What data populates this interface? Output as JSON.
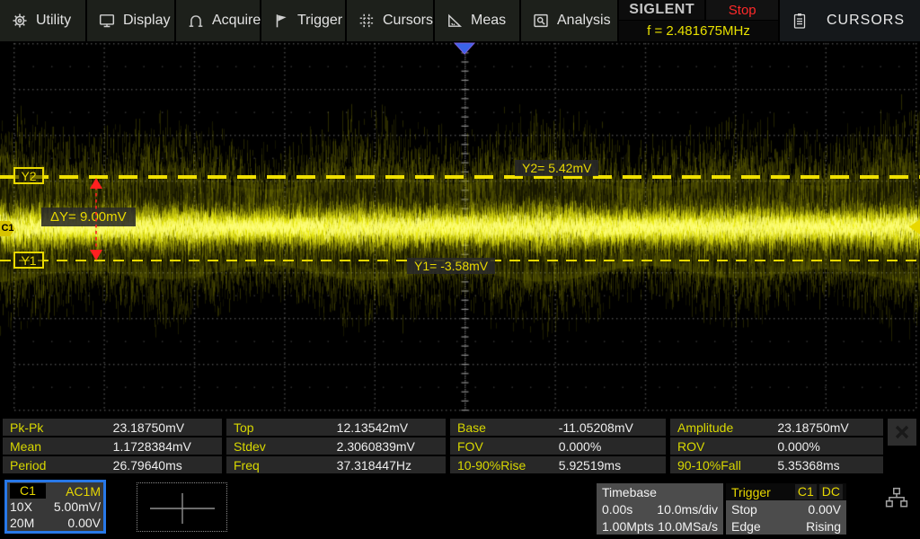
{
  "menu": {
    "items": [
      {
        "label": "Utility",
        "icon": "gear-icon"
      },
      {
        "label": "Display",
        "icon": "display-icon"
      },
      {
        "label": "Acquire",
        "icon": "acquire-icon"
      },
      {
        "label": "Trigger",
        "icon": "flag-icon"
      },
      {
        "label": "Cursors",
        "icon": "cursors-icon"
      },
      {
        "label": "Meas",
        "icon": "measure-icon"
      },
      {
        "label": "Analysis",
        "icon": "analysis-icon"
      }
    ],
    "brand": "SIGLENT",
    "run_state": "Stop",
    "frequency_counter": "f = 2.481675MHz",
    "panel_title": "CURSORS"
  },
  "cursor_overlay": {
    "y2_tag": "Y2",
    "y1_tag": "Y1",
    "y2_readout": "Y2= 5.42mV",
    "y1_readout": "Y1= -3.58mV",
    "delta_readout": "ΔY= 9.00mV",
    "channel_marker": "C1"
  },
  "measurements": {
    "rows": [
      [
        {
          "label": "Pk-Pk",
          "value": "23.18750mV"
        },
        {
          "label": "Top",
          "value": "12.13542mV"
        },
        {
          "label": "Base",
          "value": "-11.05208mV"
        },
        {
          "label": "Amplitude",
          "value": "23.18750mV"
        }
      ],
      [
        {
          "label": "Mean",
          "value": "1.1728384mV"
        },
        {
          "label": "Stdev",
          "value": "2.3060839mV"
        },
        {
          "label": "FOV",
          "value": "0.000%"
        },
        {
          "label": "ROV",
          "value": "0.000%"
        }
      ],
      [
        {
          "label": "Period",
          "value": "26.79640ms"
        },
        {
          "label": "Freq",
          "value": "37.318447Hz"
        },
        {
          "label": "10-90%Rise",
          "value": "5.92519ms"
        },
        {
          "label": "90-10%Fall",
          "value": "5.35368ms"
        }
      ]
    ]
  },
  "channel": {
    "name": "C1",
    "coupling": "AC1M",
    "attenuation": "10X",
    "scale": "5.00mV/",
    "bandwidth": "20M",
    "offset": "0.00V"
  },
  "timebase": {
    "title": "Timebase",
    "delay": "0.00s",
    "scale": "10.0ms/div",
    "memory": "1.00Mpts",
    "sample_rate": "10.0MSa/s"
  },
  "trigger": {
    "title": "Trigger",
    "source": "C1",
    "coupling": "DC",
    "status": "Stop",
    "level": "0.00V",
    "type": "Edge",
    "slope": "Rising"
  },
  "colors": {
    "trace": "#d6d600",
    "trace_bright": "#ffff82",
    "cursor_yellow": "#f0e000",
    "accent_yellow": "#e8d800",
    "status_red": "#ff2a2a",
    "trigger_blue": "#3a64e8",
    "channel_border": "#2878e8",
    "grid_dot": "#505050"
  }
}
